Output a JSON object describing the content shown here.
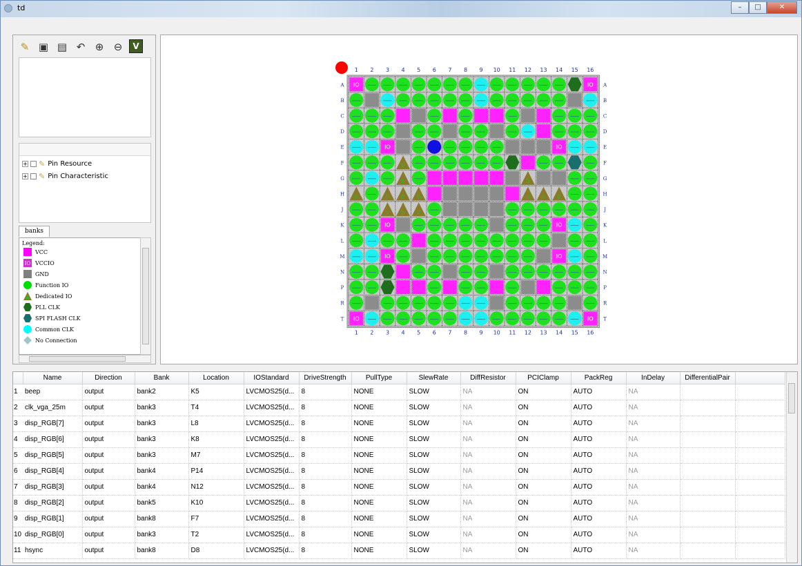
{
  "window": {
    "title": "td"
  },
  "toolbar": {
    "v_label": "V"
  },
  "tree": {
    "items": [
      "Pin Resource",
      "Pin Characteristic"
    ]
  },
  "tab_banks": "banks",
  "legend": {
    "title": "Legend:",
    "items": [
      {
        "label": "VCC",
        "icon": "vcc-icon",
        "color": "#ff00ff"
      },
      {
        "label": "VCCIO",
        "icon": "vccio-icon",
        "color": "#cc33cc"
      },
      {
        "label": "GND",
        "icon": "gnd-icon",
        "color": "#808080"
      },
      {
        "label": "Function IO",
        "icon": "function-io-icon",
        "color": "#00e000"
      },
      {
        "label": "Dedicated IO",
        "icon": "dedicated-io-icon",
        "color": "#8b7a2a"
      },
      {
        "label": "PLL CLK",
        "icon": "pll-clk-icon",
        "color": "#1e6e1e"
      },
      {
        "label": "SPI FLASH CLK",
        "icon": "spi-flash-clk-icon",
        "color": "#1b6e6e"
      },
      {
        "label": "Common CLK",
        "icon": "common-clk-icon",
        "color": "#00ffff"
      },
      {
        "label": "No Connection",
        "icon": "no-connection-icon",
        "color": "#a0c8c8"
      }
    ]
  },
  "package": {
    "col_labels": [
      "1",
      "2",
      "3",
      "4",
      "5",
      "6",
      "7",
      "8",
      "9",
      "10",
      "11",
      "12",
      "13",
      "14",
      "15",
      "16"
    ],
    "row_labels": [
      "A",
      "B",
      "C",
      "D",
      "E",
      "F",
      "G",
      "H",
      "J",
      "K",
      "L",
      "M",
      "N",
      "P",
      "R",
      "T"
    ],
    "io_label": "IO",
    "d_label": "D",
    "rows": [
      "MGGGGGGGCGGGGGPM",
      "GYCGGGGGCGGGGGYC",
      "GGGMYGMGMMGYMGGG",
      "GGGYGGYGGYGCMGGG",
      "CCMYGBGGGGYYYMCC",
      "GGGDGGGGGGPMGGSG",
      "GCGDGMMMMMYDYYGG",
      "DGDDDMYYYYMDDDGG",
      "GGDDDGYYYYGGGGGG",
      "GGMYGGGGGYGGGMCG",
      "GCGGMGGGGGGGGYGG",
      "CCMGYGGGGGGGYMCG",
      "GGPMGGYGGYGGGGGG",
      "GGPMMGMGGMGYMGGG",
      "GYGGGGGCCYGGGGYG",
      "MCGGGGGCCGGGGGCM"
    ]
  },
  "table": {
    "columns": [
      "Name",
      "Direction",
      "Bank",
      "Location",
      "IOStandard",
      "DriveStrength",
      "PullType",
      "SlewRate",
      "DiffResistor",
      "PCIClamp",
      "PackReg",
      "InDelay",
      "DifferentialPair"
    ],
    "rows": [
      {
        "num": "1",
        "cells": [
          "beep",
          "output",
          "bank2",
          "K5",
          "LVCMOS25(d...",
          "8",
          "NONE",
          "SLOW",
          "NA",
          "ON",
          "AUTO",
          "NA",
          ""
        ]
      },
      {
        "num": "2",
        "cells": [
          "clk_vga_25m",
          "output",
          "bank3",
          "T4",
          "LVCMOS25(d...",
          "8",
          "NONE",
          "SLOW",
          "NA",
          "ON",
          "AUTO",
          "NA",
          ""
        ]
      },
      {
        "num": "3",
        "cells": [
          "disp_RGB[7]",
          "output",
          "bank3",
          "L8",
          "LVCMOS25(d...",
          "8",
          "NONE",
          "SLOW",
          "NA",
          "ON",
          "AUTO",
          "NA",
          ""
        ]
      },
      {
        "num": "4",
        "cells": [
          "disp_RGB[6]",
          "output",
          "bank3",
          "K8",
          "LVCMOS25(d...",
          "8",
          "NONE",
          "SLOW",
          "NA",
          "ON",
          "AUTO",
          "NA",
          ""
        ]
      },
      {
        "num": "5",
        "cells": [
          "disp_RGB[5]",
          "output",
          "bank3",
          "M7",
          "LVCMOS25(d...",
          "8",
          "NONE",
          "SLOW",
          "NA",
          "ON",
          "AUTO",
          "NA",
          ""
        ]
      },
      {
        "num": "6",
        "cells": [
          "disp_RGB[4]",
          "output",
          "bank4",
          "P14",
          "LVCMOS25(d...",
          "8",
          "NONE",
          "SLOW",
          "NA",
          "ON",
          "AUTO",
          "NA",
          ""
        ]
      },
      {
        "num": "7",
        "cells": [
          "disp_RGB[3]",
          "output",
          "bank4",
          "N12",
          "LVCMOS25(d...",
          "8",
          "NONE",
          "SLOW",
          "NA",
          "ON",
          "AUTO",
          "NA",
          ""
        ]
      },
      {
        "num": "8",
        "cells": [
          "disp_RGB[2]",
          "output",
          "bank5",
          "K10",
          "LVCMOS25(d...",
          "8",
          "NONE",
          "SLOW",
          "NA",
          "ON",
          "AUTO",
          "NA",
          ""
        ]
      },
      {
        "num": "9",
        "cells": [
          "disp_RGB[1]",
          "output",
          "bank8",
          "F7",
          "LVCMOS25(d...",
          "8",
          "NONE",
          "SLOW",
          "NA",
          "ON",
          "AUTO",
          "NA",
          ""
        ]
      },
      {
        "num": "10",
        "cells": [
          "disp_RGB[0]",
          "output",
          "bank3",
          "T2",
          "LVCMOS25(d...",
          "8",
          "NONE",
          "SLOW",
          "NA",
          "ON",
          "AUTO",
          "NA",
          ""
        ]
      },
      {
        "num": "11",
        "cells": [
          "hsync",
          "output",
          "bank8",
          "D8",
          "LVCMOS25(d...",
          "8",
          "NONE",
          "SLOW",
          "NA",
          "ON",
          "AUTO",
          "NA",
          ""
        ]
      }
    ]
  }
}
